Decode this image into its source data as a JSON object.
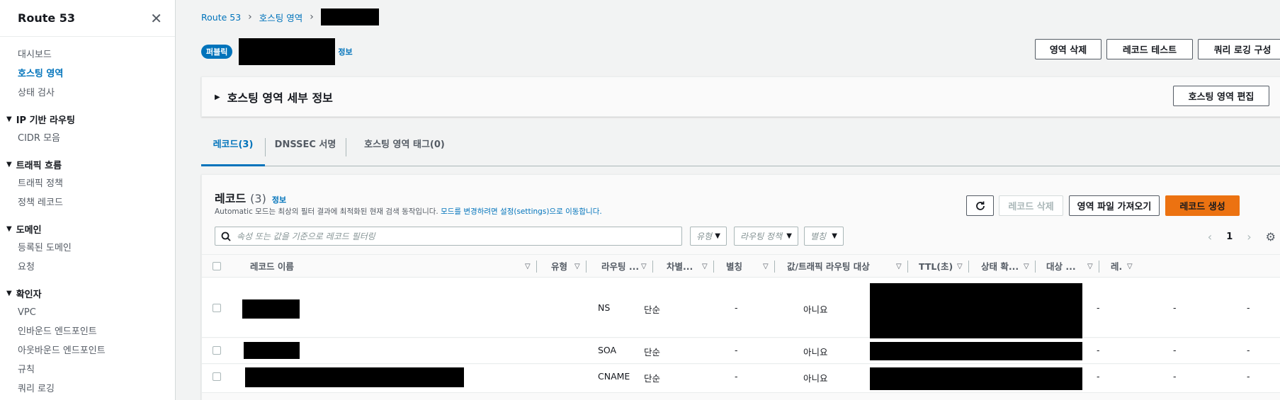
{
  "sidebar": {
    "title": "Route 53",
    "top_items": [
      "대시보드",
      "호스팅 영역",
      "상태 검사"
    ],
    "active_item": "호스팅 영역",
    "sections": [
      {
        "label": "IP 기반 라우팅",
        "items": [
          "CIDR 모음"
        ]
      },
      {
        "label": "트래픽 흐름",
        "items": [
          "트래픽 정책",
          "정책 레코드"
        ]
      },
      {
        "label": "도메인",
        "items": [
          "등록된 도메인",
          "요청"
        ]
      },
      {
        "label": "확인자",
        "items": [
          "VPC",
          "인바운드 엔드포인트",
          "아웃바운드 엔드포인트",
          "규칙",
          "쿼리 로깅"
        ]
      }
    ]
  },
  "breadcrumb": {
    "root": "Route 53",
    "section": "호스팅 영역"
  },
  "header": {
    "badge": "퍼블릭",
    "info": "정보",
    "buttons": {
      "delete_zone": "영역 삭제",
      "test_record": "레코드 테스트",
      "query_logging": "쿼리 로깅 구성"
    }
  },
  "details": {
    "title": "호스팅 영역 세부 정보",
    "edit_button": "호스팅 영역 편집"
  },
  "tabs": [
    "레코드(3)",
    "DNSSEC 서명",
    "호스팅 영역 태그(0)"
  ],
  "records": {
    "title": "레코드",
    "count": "(3)",
    "info": "정보",
    "desc_prefix": "Automatic 모드는 최상의 필터 결과에 최적화된 현재 검색 동작입니다.",
    "desc_link": "모드를 변경하려면 설정(settings)으로 이동합니다.",
    "buttons": {
      "delete": "레코드 삭제",
      "import": "영역 파일 가져오기",
      "create": "레코드 생성"
    },
    "filter_placeholder": "속성 또는 값을 기준으로 레코드 필터링",
    "dropdowns": [
      "유형",
      "라우팅 정책",
      "별칭"
    ],
    "page": "1",
    "columns": [
      "레코드 이름",
      "유형",
      "라우팅 ...",
      "차별...",
      "별칭",
      "값/트래픽 라우팅 대상",
      "TTL(초)",
      "상태 확...",
      "대상 ...",
      "레."
    ],
    "rows": [
      {
        "type": "NS",
        "routing": "단순",
        "differentiator": "-",
        "alias": "아니요",
        "health": "-",
        "target": "-",
        "extra": "-"
      },
      {
        "type": "SOA",
        "routing": "단순",
        "differentiator": "-",
        "alias": "아니요",
        "health": "-",
        "target": "-",
        "extra": "-"
      },
      {
        "type": "CNAME",
        "routing": "단순",
        "differentiator": "-",
        "alias": "아니요",
        "health": "-",
        "target": "-",
        "extra": "-"
      }
    ]
  }
}
